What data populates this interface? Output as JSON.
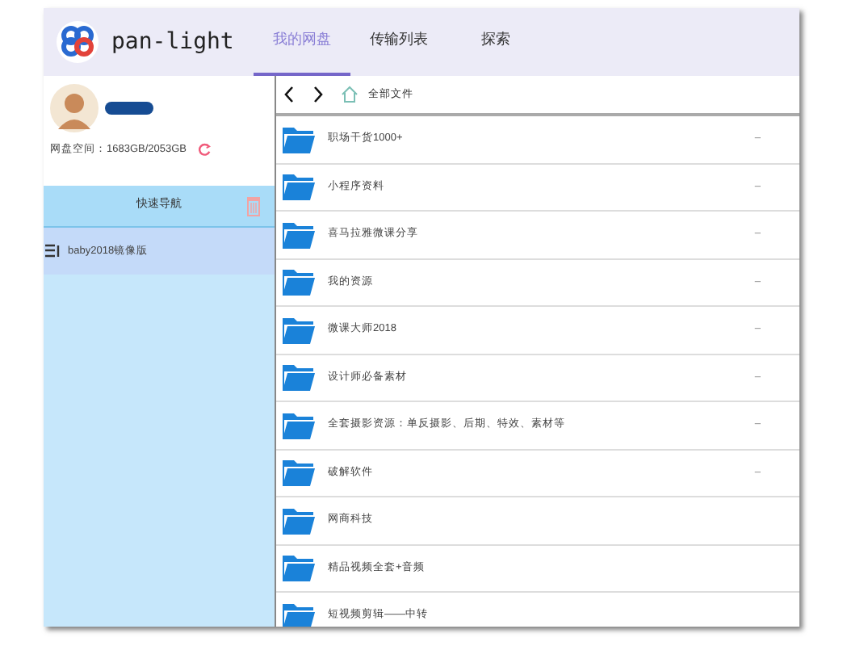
{
  "app": {
    "title": "pan-light"
  },
  "tabs": [
    {
      "label": "我的网盘",
      "selected": true
    },
    {
      "label": "传输列表",
      "selected": false
    },
    {
      "label": "探索",
      "selected": false
    }
  ],
  "account": {
    "quota": "网盘空间：1683GB/2053GB"
  },
  "quick_nav": {
    "title": "快速导航",
    "items": [
      {
        "label": "baby2018镜像版",
        "selected": true
      }
    ]
  },
  "breadcrumb": {
    "path": "全部文件"
  },
  "files": [
    {
      "name": "职场干货1000+",
      "size": "–"
    },
    {
      "name": "小程序资料",
      "size": "–"
    },
    {
      "name": "喜马拉雅微课分享",
      "size": "–"
    },
    {
      "name": "我的资源",
      "size": "–"
    },
    {
      "name": "微课大师2018",
      "size": "–"
    },
    {
      "name": "设计师必备素材",
      "size": "–"
    },
    {
      "name": "全套摄影资源：单反摄影、后期、特效、素材等",
      "size": "–"
    },
    {
      "name": "破解软件",
      "size": "–"
    },
    {
      "name": "网商科技"
    },
    {
      "name": "精品视频全套+音频"
    },
    {
      "name": "短视频剪辑——中转"
    }
  ]
}
